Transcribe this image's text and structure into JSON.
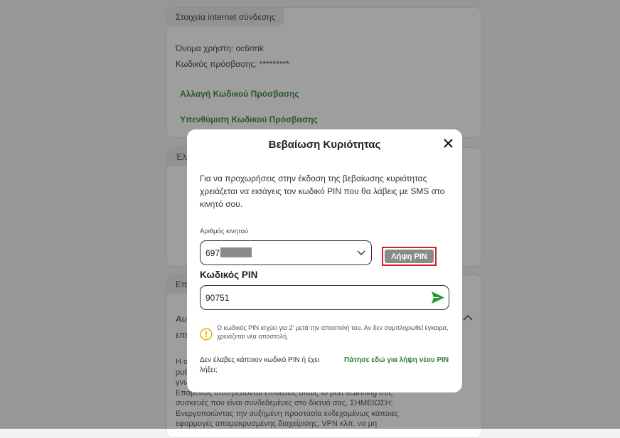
{
  "background": {
    "card1": {
      "tab": "Στοιχεία internet σύνδεσης",
      "username": "Όνομα χρήστη: oc6rmk",
      "password": "Κωδικός πρόσβασης: *********",
      "link_change": "Αλλαγή Κωδικού Πρόσβασης",
      "link_reminder": "Υπενθύμιση Κωδικού Πρόσβασης"
    },
    "card2": {
      "tab": "Έλε"
    },
    "card3": {
      "tab": "Επι",
      "heading_1": "Αυ",
      "heading_2": "επι",
      "paragraph_lines": [
        "Η α",
        "ρυθ",
        "γνω",
        "Επομένως αποτρέπονται επιθέσεις όπως το port scanning στις",
        "συσκευές που είναι συνδεδεμένες στο δίκτυό σας. ΣΗΜΕΙΩΣΗ:",
        "Ενεργοποιώντας την αυξημένη προστασία ενδεχομένως κάποιες",
        "εφαρμογές απομακρυσμένης διαχείρισης, VPN κλπ. να μη"
      ]
    }
  },
  "modal": {
    "title": "Βεβαίωση Κυριότητας",
    "intro": "Για να προχωρήσεις στην έκδοση της βεβαίωσης κυριότητας χρειάζεται να εισάγεις τον κωδικό PIN που θα λάβεις με SMS στο κινητό σου.",
    "mobile_label": "Αριθμός κινητού",
    "mobile_value": "697-",
    "get_pin_button": "Λήψη PIN",
    "pin_label": "Κωδικός PIN",
    "pin_value": "90751",
    "info_text": "Ο κωδικός PIN ισχύει για 2' μετά την αποστολή του. Αν δεν συμπληρωθεί έγκαιρα, χρειάζεται νέα αποστολή.",
    "resend_question": "Δεν έλαβες κάποιον κωδικό PIN ή έχει λήξει;",
    "resend_link": "Πάτησε εδώ για λήψη νέου PIN"
  },
  "colors": {
    "accent_green": "#2e7d32",
    "send_green": "#1e9a2c",
    "info_yellow": "#e0b300",
    "highlight_red": "#d0202a"
  },
  "icons": {
    "close": "close-icon",
    "chevron": "chevron-down-icon",
    "send": "send-icon",
    "info": "info-icon",
    "collapse": "chevron-up-icon"
  }
}
